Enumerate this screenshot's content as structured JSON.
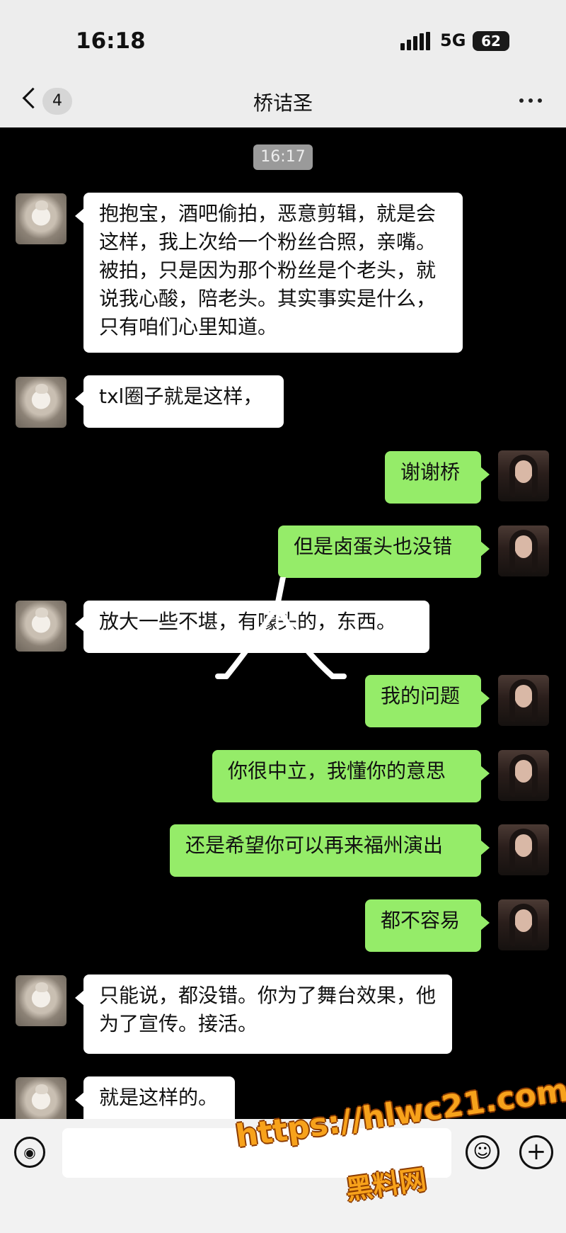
{
  "status": {
    "time": "16:18",
    "network": "5G",
    "battery": "62"
  },
  "header": {
    "unread": "4",
    "title": "桥诘圣"
  },
  "timestamp": "16:17",
  "messages": [
    {
      "from": "friend",
      "text": "抱抱宝，酒吧偷拍，恶意剪辑，就是会这样，我上次给一个粉丝合照，亲嘴。被拍，只是因为那个粉丝是个老头，就说我心酸，陪老头。其实事实是什么，只有咱们心里知道。"
    },
    {
      "from": "friend",
      "text": "txl圈子就是这样，"
    },
    {
      "from": "me",
      "text": "谢谢桥"
    },
    {
      "from": "me",
      "text": "但是卤蛋头也没错"
    },
    {
      "from": "friend",
      "text": "放大一些不堪，有噱头的，东西。"
    },
    {
      "from": "me",
      "text": "我的问题"
    },
    {
      "from": "me",
      "text": "你很中立，我懂你的意思"
    },
    {
      "from": "me",
      "text": "还是希望你可以再来福州演出"
    },
    {
      "from": "me",
      "text": "都不容易"
    },
    {
      "from": "friend",
      "text": "只能说，都没错。你为了舞台效果，他为了宣传。接活。"
    },
    {
      "from": "friend",
      "text": "就是这样的。"
    }
  ],
  "watermark": {
    "url": "https://hlwc21.com",
    "label": "黑料网"
  },
  "colors": {
    "outgoing_bubble": "#95ec69",
    "incoming_bubble": "#ffffff",
    "chat_bg": "#000000",
    "bar_bg": "#ededed"
  },
  "icons": [
    "back-icon",
    "more-icon",
    "voice-icon",
    "emoji-icon",
    "plus-icon"
  ]
}
